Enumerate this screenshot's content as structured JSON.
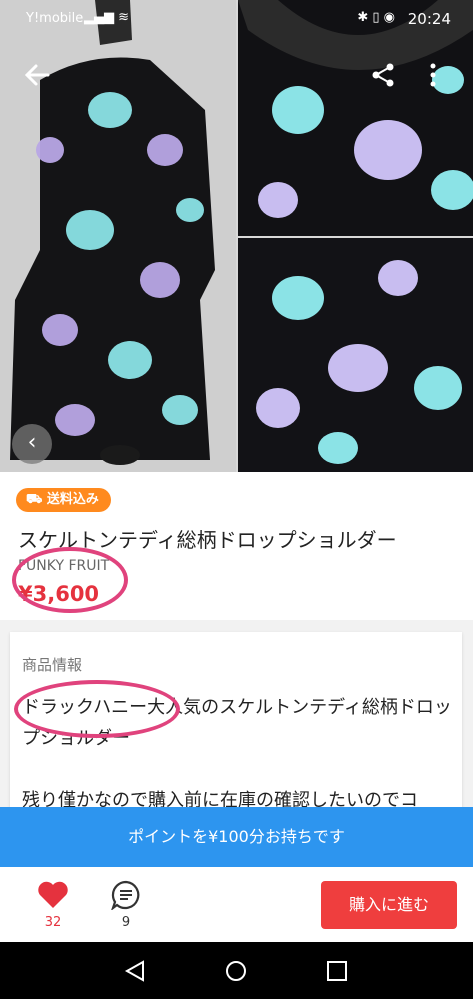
{
  "status_bar": {
    "carrier": "Y!mobile",
    "time": "20:24"
  },
  "header": {
    "back_icon": "arrow-left-icon",
    "share_icon": "share-icon",
    "more_icon": "more-vertical-icon"
  },
  "product": {
    "shipping_badge": "送料込み",
    "title": "スケルトンテディ総柄ドロップショルダー",
    "brand": "FUNKY FRUIT",
    "price": "¥3,600"
  },
  "description": {
    "heading": "商品情報",
    "text": "ドラックハニー大人気のスケルトンテディ総柄ドロップショルダー\n\n残り僅かなので購入前に在庫の確認したいのでコ"
  },
  "points_banner": "ポイントを¥100分お持ちです",
  "action_bar": {
    "likes": "32",
    "comments": "9",
    "buy_label": "購入に進む"
  },
  "colors": {
    "accent": "#ef3e3e",
    "price": "#e5323e",
    "badge": "#ff8a1e",
    "banner": "#2d95ef",
    "annotation": "#e0437d"
  }
}
